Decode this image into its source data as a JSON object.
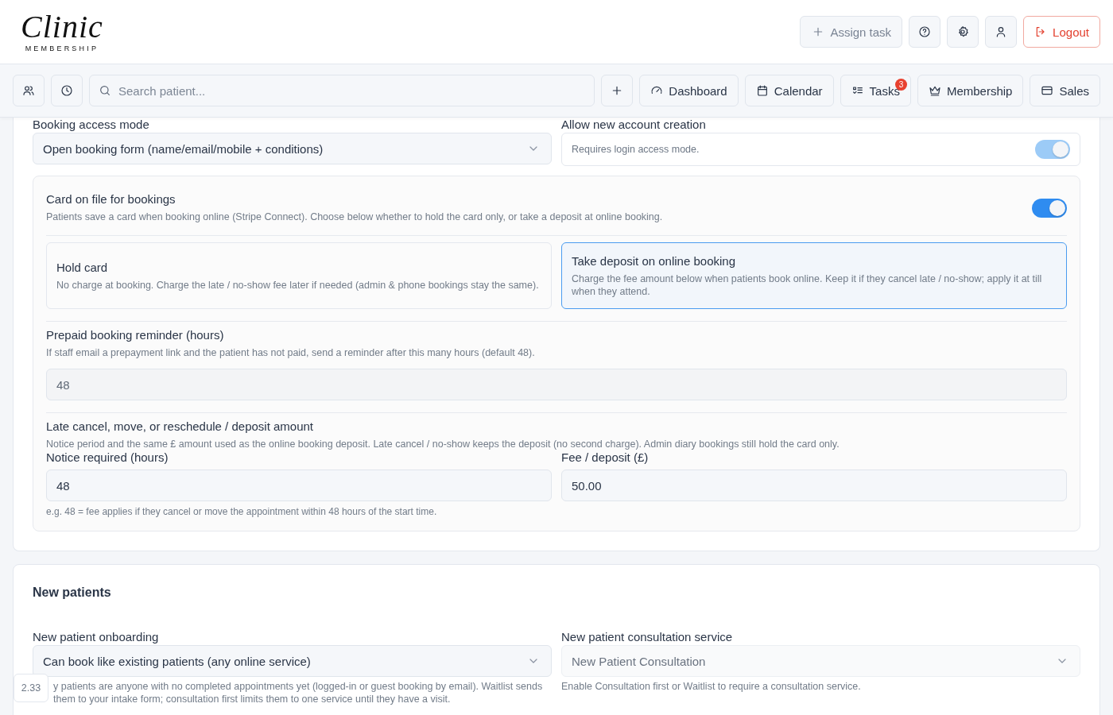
{
  "header": {
    "logo": {
      "wordmark": "Clinic",
      "tagline": "MEMBERSHIP"
    },
    "actions": [
      {
        "kind": "labelled",
        "label": "Assign task"
      },
      {
        "kind": "icon"
      },
      {
        "kind": "icon"
      },
      {
        "kind": "icon"
      },
      {
        "kind": "danger",
        "label": "Logout"
      }
    ]
  },
  "nav": {
    "tools": [
      {
        "kind": "icon"
      },
      {
        "kind": "icon"
      }
    ],
    "search": {
      "placeholder": "Search patient..."
    },
    "add": {
      "kind": "icon"
    },
    "links": [
      {
        "label": "Dashboard"
      },
      {
        "label": "Calendar"
      },
      {
        "label": "Tasks",
        "badge": "3"
      },
      {
        "label": "Membership"
      },
      {
        "label": "Sales"
      }
    ]
  },
  "booking_access": {
    "label": "Booking access mode",
    "value": "Open booking form (name/email/mobile + conditions)"
  },
  "account_creation": {
    "label": "Allow new account creation",
    "note": "Requires login access mode.",
    "on": true,
    "disabled": true
  },
  "card_on_file": {
    "title": "Card on file for bookings",
    "description": "Patients save a card when booking online (Stripe Connect). Choose below whether to hold the card only, or take a deposit at online booking.",
    "on": true,
    "disabled": false,
    "options": [
      {
        "title": "Hold card",
        "description": "No charge at booking. Charge the late / no-show fee later if needed (admin & phone bookings stay the same).",
        "selected": false
      },
      {
        "title": "Take deposit on online booking",
        "description": "Charge the fee amount below when patients book online. Keep it if they cancel late / no-show; apply it at till when they attend.",
        "selected": true
      }
    ],
    "reminder": {
      "title": "Prepaid booking reminder (hours)",
      "description": "If staff email a prepayment link and the patient has not paid, send a reminder after this many hours (default 48).",
      "value": "48",
      "disabled": true
    },
    "late_cancel": {
      "title": "Late cancel, move, or reschedule / deposit amount",
      "description": "Notice period and the same £ amount used as the online booking deposit. Late cancel / no-show keeps the deposit (no second charge). Admin diary bookings still hold the card only.",
      "fields": [
        {
          "label": "Notice required (hours)",
          "value": "48",
          "disabled": false
        },
        {
          "label": "Fee / deposit (£)",
          "value": "50.00",
          "disabled": false
        }
      ],
      "hint": "e.g. 48 = fee applies if they cancel or move the appointment within 48 hours of the start time."
    }
  },
  "new_patients": {
    "heading": "New patients",
    "fields": [
      {
        "label": "New patient onboarding",
        "value": "Can book like existing patients (any online service)",
        "help": "y patients are anyone with no completed appointments yet (logged-in or guest booking by email). Waitlist sends them to your intake form; consultation first limits them to one service until they have a visit.",
        "disabled": false
      },
      {
        "label": "New patient consultation service",
        "value": "New Patient Consultation",
        "help": "Enable Consultation first or Waitlist to require a consultation service.",
        "disabled": true
      }
    ]
  },
  "version_badge": "2.33"
}
